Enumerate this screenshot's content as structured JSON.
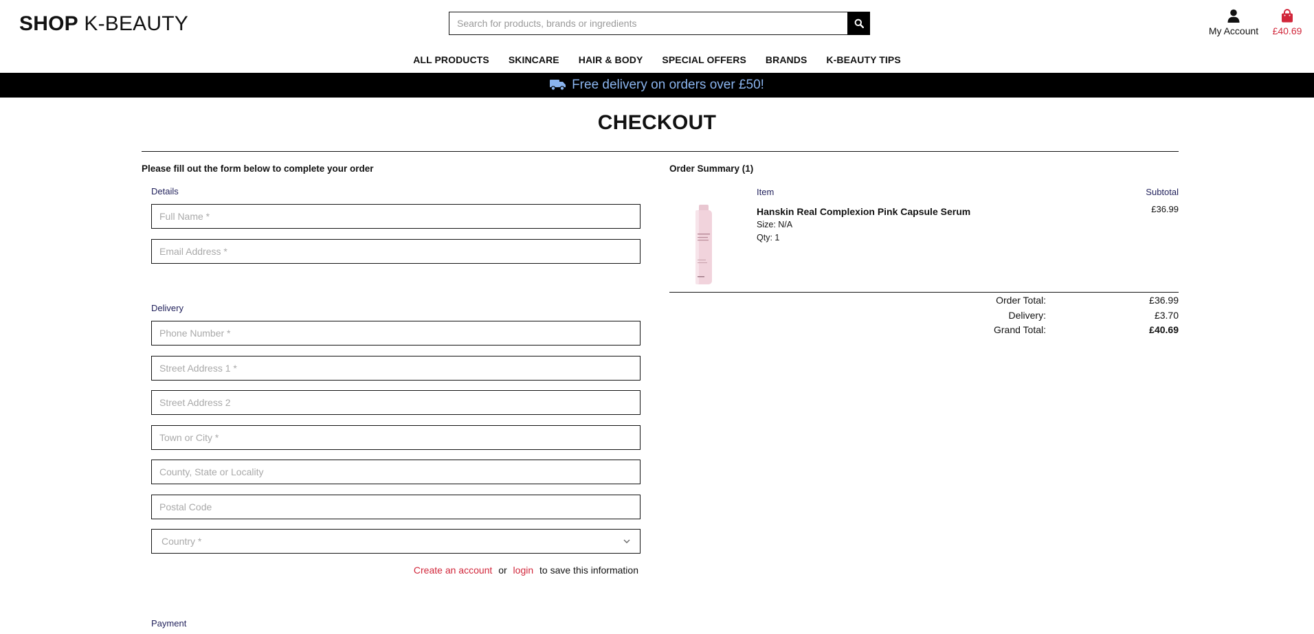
{
  "header": {
    "logo_bold": "SHOP",
    "logo_rest": " K-BEAUTY",
    "search_placeholder": "Search for products, brands or ingredients",
    "account_label": "My Account",
    "cart_total": "£40.69"
  },
  "nav": [
    "ALL PRODUCTS",
    "SKINCARE",
    "HAIR & BODY",
    "SPECIAL OFFERS",
    "BRANDS",
    "K-BEAUTY TIPS"
  ],
  "banner": {
    "text": "Free delivery on orders over £50!"
  },
  "page_title": "CHECKOUT",
  "form": {
    "intro": "Please fill out the form below to complete your order",
    "details_label": "Details",
    "full_name_placeholder": "Full Name *",
    "email_placeholder": "Email Address *",
    "delivery_label": "Delivery",
    "phone_placeholder": "Phone Number *",
    "street1_placeholder": "Street Address 1 *",
    "street2_placeholder": "Street Address 2",
    "town_placeholder": "Town or City *",
    "county_placeholder": "County, State or Locality",
    "postcode_placeholder": "Postal Code",
    "country_placeholder": "Country *",
    "create_account": "Create an account",
    "or_text": "or",
    "login": "login",
    "save_text": "to save this information",
    "payment_label": "Payment"
  },
  "summary": {
    "title": "Order Summary (1)",
    "col_item": "Item",
    "col_subtotal": "Subtotal",
    "product": {
      "name": "Hanskin Real Complexion Pink Capsule Serum",
      "size": "Size: N/A",
      "qty": "Qty: 1",
      "price": "£36.99"
    },
    "order_total_label": "Order Total:",
    "order_total": "£36.99",
    "delivery_label": "Delivery:",
    "delivery": "£3.70",
    "grand_total_label": "Grand Total:",
    "grand_total": "£40.69"
  },
  "colors": {
    "accent_red": "#d1263a",
    "banner_text": "#8ab4ee",
    "label_navy": "#1f1f5a"
  }
}
